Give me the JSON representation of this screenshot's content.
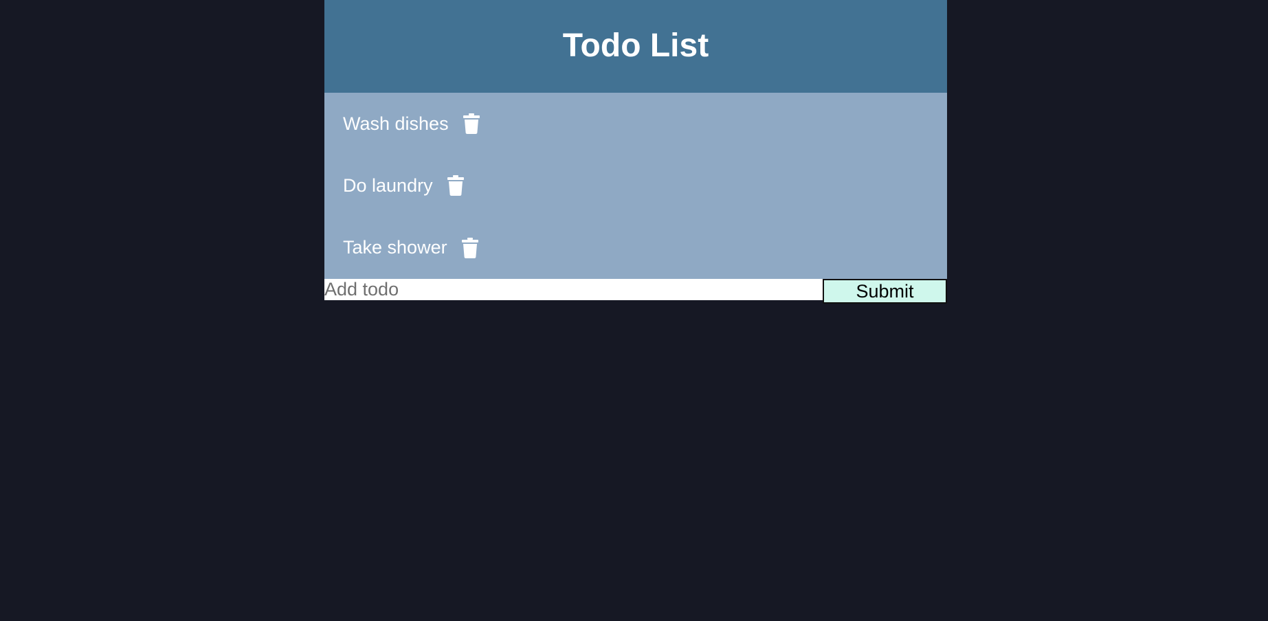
{
  "app": {
    "title": "Todo List"
  },
  "todos": [
    {
      "label": "Wash dishes",
      "delete_icon": "trash-icon"
    },
    {
      "label": "Do laundry",
      "delete_icon": "trash-icon"
    },
    {
      "label": "Take shower",
      "delete_icon": "trash-icon"
    }
  ],
  "form": {
    "input_value": "",
    "input_placeholder": "Add todo",
    "submit_label": "Submit"
  },
  "colors": {
    "page_background": "#161824",
    "header_background": "#427293",
    "list_background": "#8fa9c4",
    "submit_background": "#cff7ec",
    "text_light": "#ffffff"
  }
}
